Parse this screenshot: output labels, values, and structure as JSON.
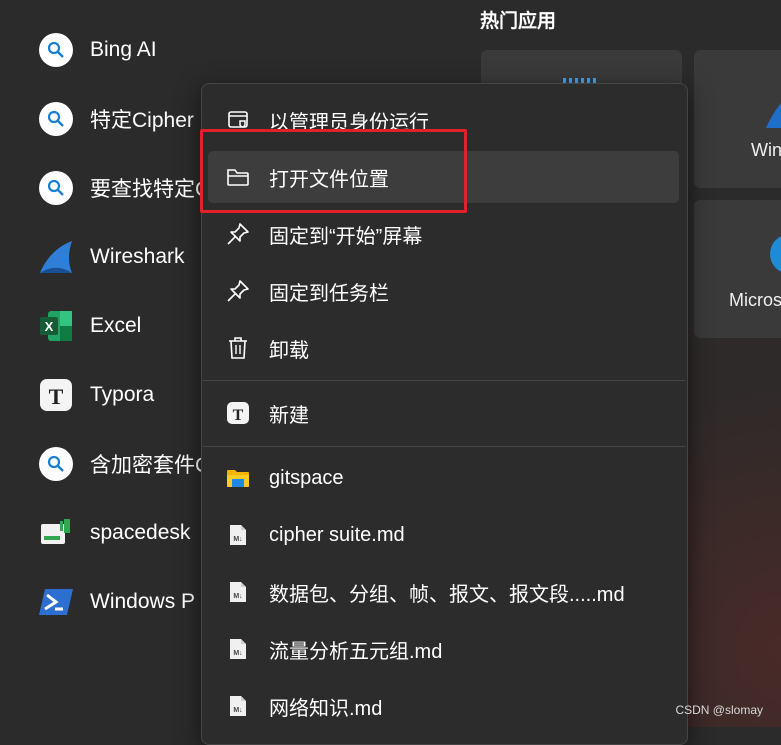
{
  "left_apps": [
    {
      "label": "Bing AI",
      "icon": "search-icon"
    },
    {
      "label": "特定Cipher",
      "icon": "search-icon"
    },
    {
      "label": "要查找特定C",
      "icon": "search-icon"
    },
    {
      "label": "Wireshark",
      "icon": "wireshark-icon"
    },
    {
      "label": "Excel",
      "icon": "excel-icon"
    },
    {
      "label": "Typora",
      "icon": "typora-icon"
    },
    {
      "label": "含加密套件Cl",
      "icon": "search-icon"
    },
    {
      "label": "spacedesk",
      "icon": "spacedesk-icon"
    },
    {
      "label": "Windows P",
      "icon": "powershell-icon"
    }
  ],
  "popular": {
    "title": "热门应用",
    "tiles": [
      {
        "label": "",
        "icon": "app-icon"
      },
      {
        "label": "Win",
        "icon": "wireshark-icon"
      },
      {
        "label": "Micros",
        "icon": "edge-icon"
      }
    ]
  },
  "context_menu": {
    "items": [
      {
        "label": "以管理员身份运行",
        "icon": "shield-window-icon"
      },
      {
        "label": "打开文件位置",
        "icon": "folder-icon",
        "highlighted": true
      },
      {
        "label": "固定到“开始”屏幕",
        "icon": "pin-icon"
      },
      {
        "label": "固定到任务栏",
        "icon": "pin-icon"
      },
      {
        "label": "卸载",
        "icon": "trash-icon"
      }
    ],
    "new_section": [
      {
        "label": "新建",
        "icon": "typora-icon"
      }
    ],
    "recent": [
      {
        "label": "gitspace",
        "icon": "folder-yellow-icon"
      },
      {
        "label": "cipher suite.md",
        "icon": "markdown-file-icon"
      },
      {
        "label": "数据包、分组、帧、报文、报文段.....md",
        "icon": "markdown-file-icon"
      },
      {
        "label": "流量分析五元组.md",
        "icon": "markdown-file-icon"
      },
      {
        "label": "网络知识.md",
        "icon": "markdown-file-icon"
      }
    ]
  },
  "watermark": "CSDN @slomay",
  "colors": {
    "highlight_border": "#e3212a",
    "menu_bg": "#2c2c2c",
    "hover_bg": "#3d3d3d"
  }
}
